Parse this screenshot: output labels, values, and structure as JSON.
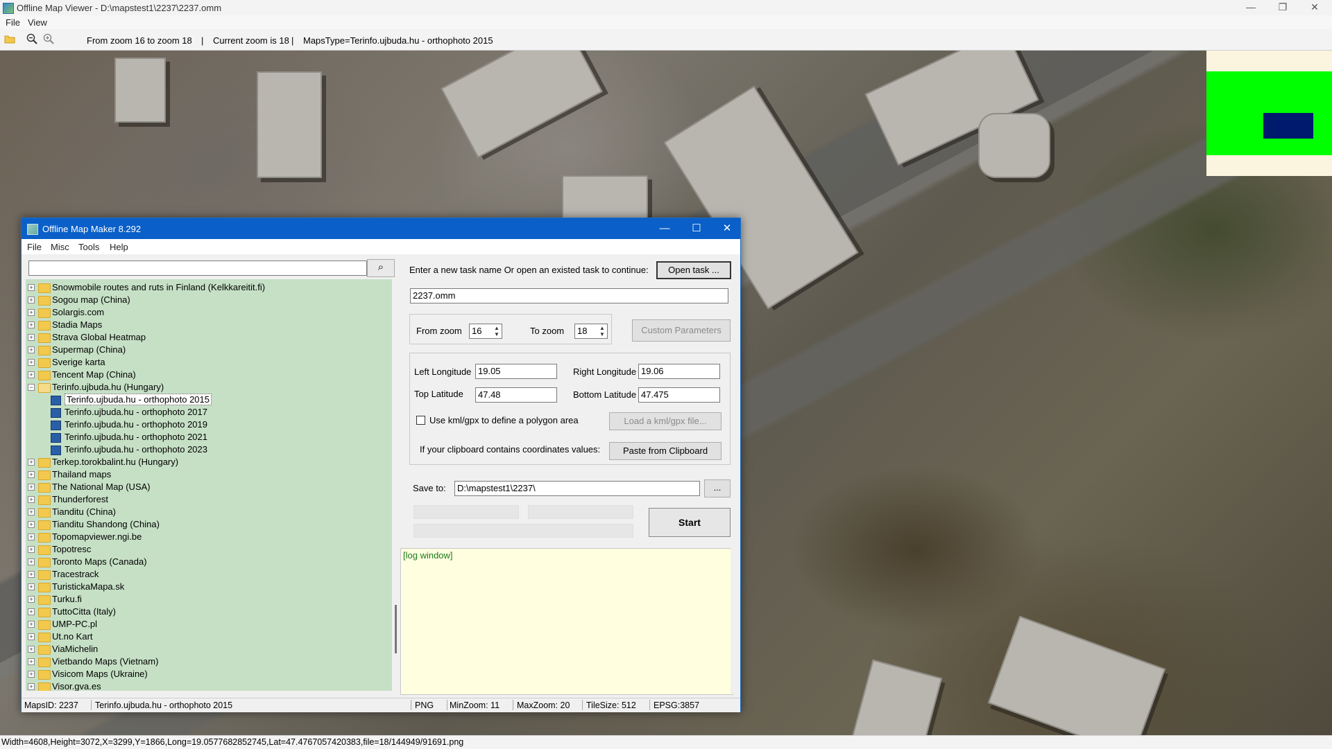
{
  "window": {
    "title": "Offline Map Viewer - D:\\mapstest1\\2237\\2237.omm",
    "controls": [
      "—",
      "❐",
      "✕"
    ]
  },
  "menu": [
    "File",
    "View"
  ],
  "toolbar": {
    "zoom_range": "From zoom 16 to zoom 18",
    "current_zoom": "Current zoom is 18",
    "maps_type": "MapsType=Terinfo.ujbuda.hu - orthophoto 2015",
    "separator": "|"
  },
  "statusbar": "Width=4608,Height=3072,X=3299,Y=1866,Long=19.0577682852745,Lat=47.4767057420383,file=18/144949/91691.png",
  "overview_colors": {
    "background": "#fbf4de",
    "area": "#00ff00",
    "viewport": "#001a6e"
  },
  "dialog": {
    "title": "Offline Map Maker 8.292",
    "controls": [
      "—",
      "☐",
      "✕"
    ],
    "menu": [
      "File",
      "Misc",
      "Tools",
      "Help"
    ],
    "search": {
      "value": "",
      "button_icon": "⌕"
    },
    "tree": [
      {
        "label": "Snowmobile routes and ruts in Finland (Kelkkareitit.fi)",
        "type": "folder",
        "level": 0,
        "expander": "+"
      },
      {
        "label": "Sogou map (China)",
        "type": "folder",
        "level": 0,
        "expander": "+"
      },
      {
        "label": "Solargis.com",
        "type": "folder",
        "level": 0,
        "expander": "+"
      },
      {
        "label": "Stadia Maps",
        "type": "folder",
        "level": 0,
        "expander": "+"
      },
      {
        "label": "Strava Global Heatmap",
        "type": "folder",
        "level": 0,
        "expander": "+"
      },
      {
        "label": "Supermap (China)",
        "type": "folder",
        "level": 0,
        "expander": "+"
      },
      {
        "label": "Sverige karta",
        "type": "folder",
        "level": 0,
        "expander": "+"
      },
      {
        "label": "Tencent Map (China)",
        "type": "folder",
        "level": 0,
        "expander": "+"
      },
      {
        "label": "Terinfo.ujbuda.hu (Hungary)",
        "type": "folder-open",
        "level": 0,
        "expander": "−"
      },
      {
        "label": "Terinfo.ujbuda.hu - orthophoto 2015",
        "type": "map",
        "level": 1,
        "selected": true
      },
      {
        "label": "Terinfo.ujbuda.hu - orthophoto 2017",
        "type": "map",
        "level": 1
      },
      {
        "label": "Terinfo.ujbuda.hu - orthophoto 2019",
        "type": "map",
        "level": 1
      },
      {
        "label": "Terinfo.ujbuda.hu - orthophoto 2021",
        "type": "map",
        "level": 1
      },
      {
        "label": "Terinfo.ujbuda.hu - orthophoto 2023",
        "type": "map",
        "level": 1
      },
      {
        "label": "Terkep.torokbalint.hu (Hungary)",
        "type": "folder",
        "level": 0,
        "expander": "+"
      },
      {
        "label": "Thailand maps",
        "type": "folder",
        "level": 0,
        "expander": "+"
      },
      {
        "label": "The National Map (USA)",
        "type": "folder",
        "level": 0,
        "expander": "+"
      },
      {
        "label": "Thunderforest",
        "type": "folder",
        "level": 0,
        "expander": "+"
      },
      {
        "label": "Tianditu (China)",
        "type": "folder",
        "level": 0,
        "expander": "+"
      },
      {
        "label": "Tianditu Shandong (China)",
        "type": "folder",
        "level": 0,
        "expander": "+"
      },
      {
        "label": "Topomapviewer.ngi.be",
        "type": "folder",
        "level": 0,
        "expander": "+"
      },
      {
        "label": "Topotresc",
        "type": "folder",
        "level": 0,
        "expander": "+"
      },
      {
        "label": "Toronto Maps (Canada)",
        "type": "folder",
        "level": 0,
        "expander": "+"
      },
      {
        "label": "Tracestrack",
        "type": "folder",
        "level": 0,
        "expander": "+"
      },
      {
        "label": "TuristickaMapa.sk",
        "type": "folder",
        "level": 0,
        "expander": "+"
      },
      {
        "label": "Turku.fi",
        "type": "folder",
        "level": 0,
        "expander": "+"
      },
      {
        "label": "TuttoCitta (Italy)",
        "type": "folder",
        "level": 0,
        "expander": "+"
      },
      {
        "label": "UMP-PC.pl",
        "type": "folder",
        "level": 0,
        "expander": "+"
      },
      {
        "label": "Ut.no Kart",
        "type": "folder",
        "level": 0,
        "expander": "+"
      },
      {
        "label": "ViaMichelin",
        "type": "folder",
        "level": 0,
        "expander": "+"
      },
      {
        "label": "Vietbando Maps (Vietnam)",
        "type": "folder",
        "level": 0,
        "expander": "+"
      },
      {
        "label": "Visicom Maps (Ukraine)",
        "type": "folder",
        "level": 0,
        "expander": "+"
      },
      {
        "label": "Visor.gva.es",
        "type": "folder",
        "level": 0,
        "expander": "+"
      }
    ],
    "task_prompt": "Enter a new task name Or open an existed task to continue:",
    "open_task_button": "Open task ...",
    "task_name": "2237.omm",
    "from_zoom_label": "From zoom",
    "from_zoom": "16",
    "to_zoom_label": "To zoom",
    "to_zoom": "18",
    "custom_params_button": "Custom Parameters",
    "left_longitude_label": "Left Longitude",
    "left_longitude": "19.05",
    "right_longitude_label": "Right Longitude",
    "right_longitude": "19.06",
    "top_latitude_label": "Top Latitude",
    "top_latitude": "47.48",
    "bottom_latitude_label": "Bottom Latitude",
    "bottom_latitude": "47.475",
    "kml_checkbox_label": "Use kml/gpx to define a polygon area",
    "load_kml_button": "Load a kml/gpx file...",
    "clipboard_label": "If your clipboard contains coordinates values:",
    "paste_button": "Paste from Clipboard",
    "save_to_label": "Save to:",
    "save_to": "D:\\mapstest1\\2237\\",
    "browse_button": "...",
    "start_button": "Start",
    "log_text": "[log window]",
    "status": {
      "maps_id": "MapsID: 2237",
      "maps_name": "Terinfo.ujbuda.hu - orthophoto 2015",
      "format": "PNG",
      "min_zoom": "MinZoom: 11",
      "max_zoom": "MaxZoom: 20",
      "tile_size": "TileSize: 512",
      "epsg": "EPSG:3857"
    }
  }
}
